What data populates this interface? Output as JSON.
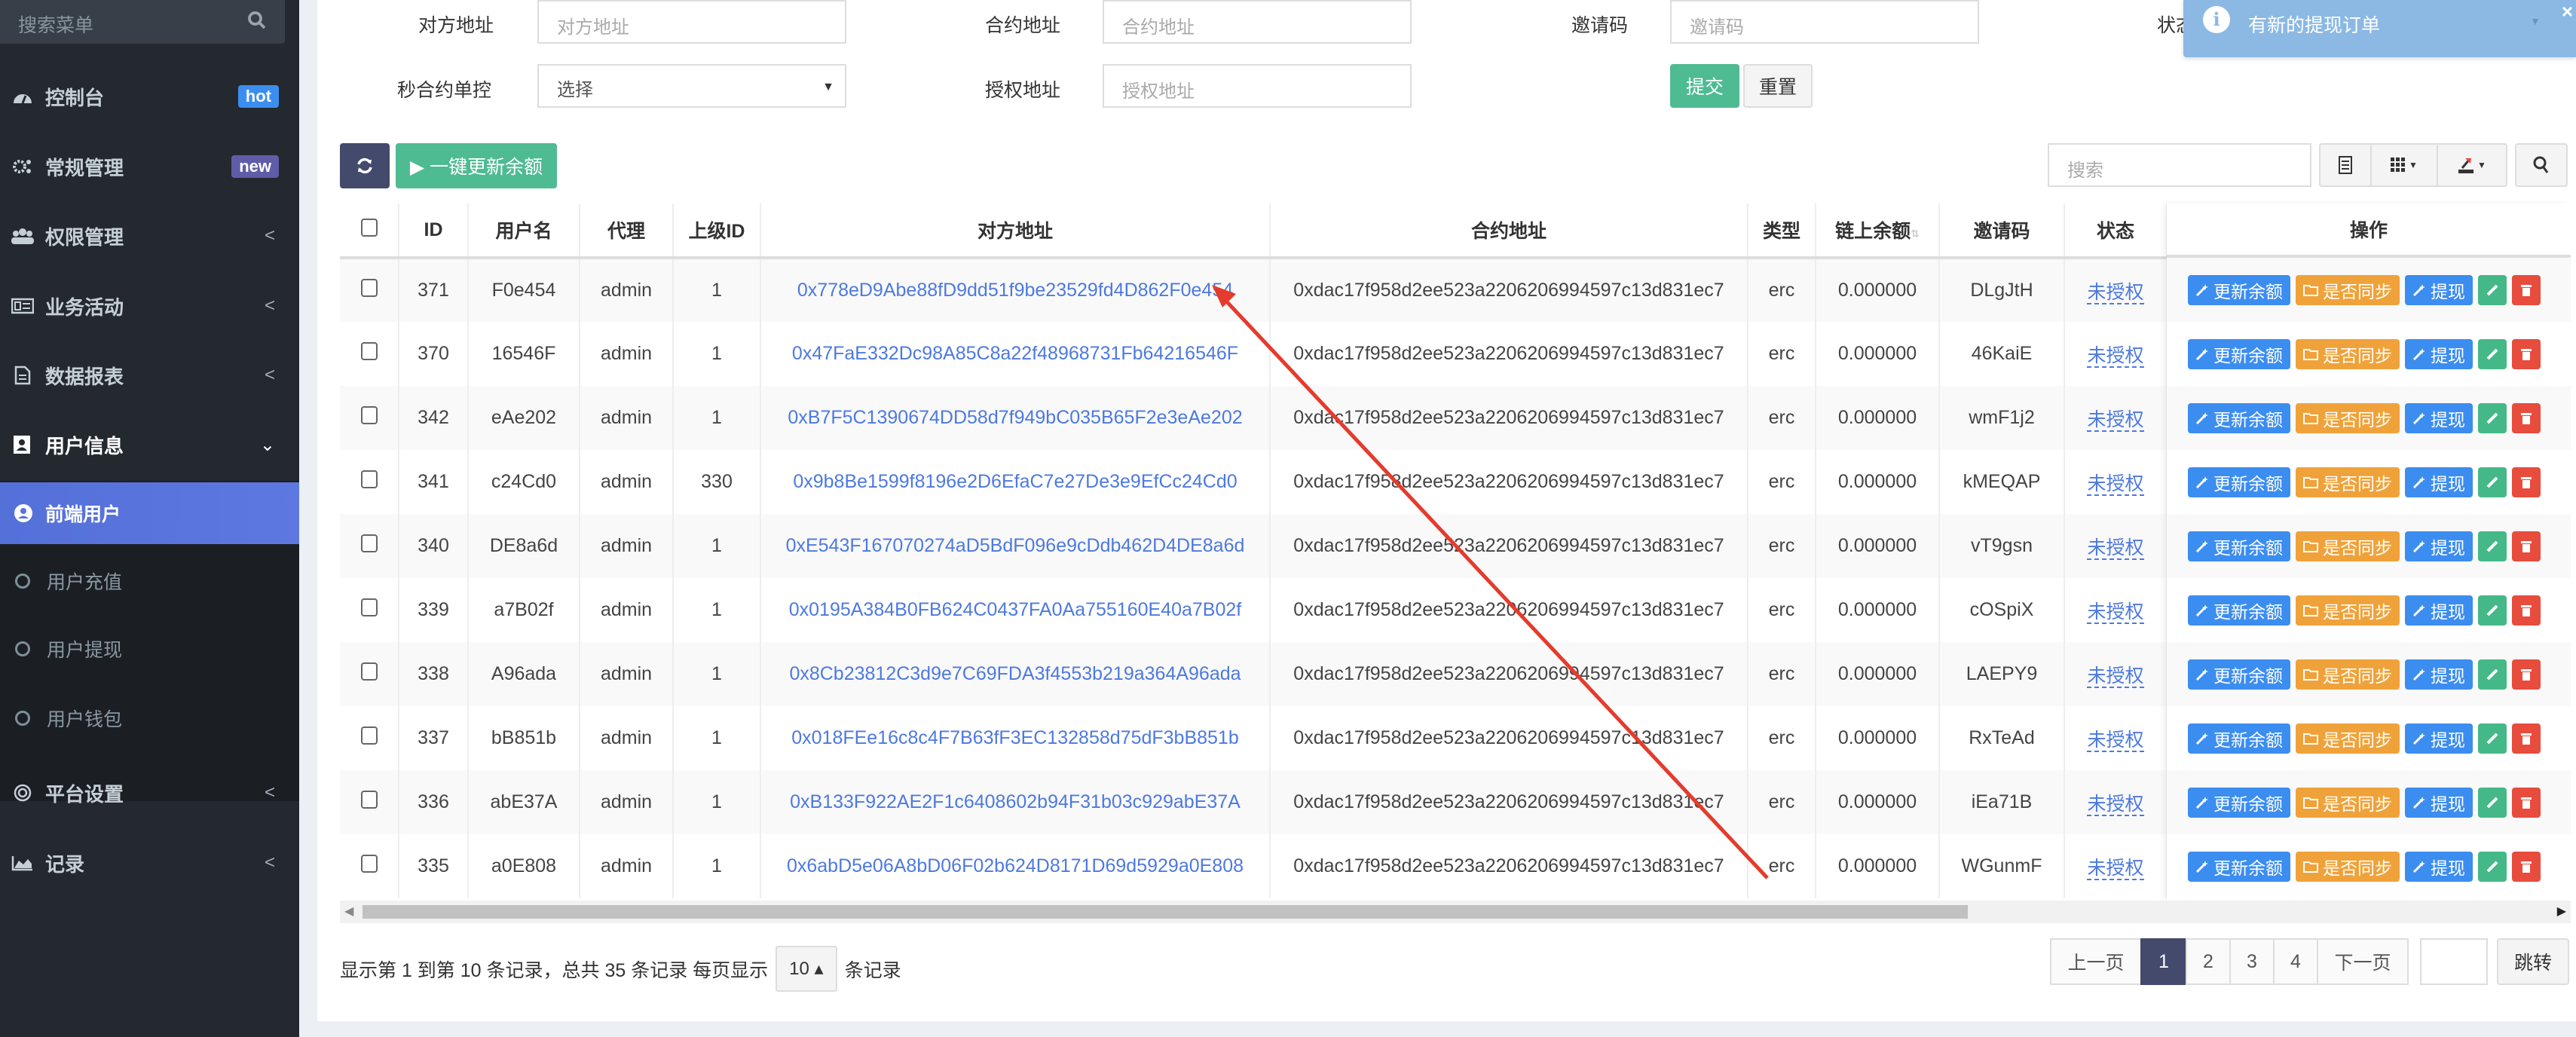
{
  "sidebar": {
    "search_placeholder": "搜索菜单",
    "items": [
      {
        "label": "控制台",
        "badge": "hot",
        "badge_color": "#3c8df0"
      },
      {
        "label": "常规管理",
        "badge": "new",
        "badge_color": "#605ca8"
      },
      {
        "label": "权限管理",
        "chevron": "<"
      },
      {
        "label": "业务活动",
        "chevron": "<"
      },
      {
        "label": "数据报表",
        "chevron": "<"
      },
      {
        "label": "用户信息",
        "chevron": "⌄"
      },
      {
        "label": "平台设置",
        "chevron": "<"
      },
      {
        "label": "记录",
        "chevron": "<"
      }
    ],
    "active_sub": "前端用户",
    "sub_items": [
      "用户充值",
      "用户提现",
      "用户钱包"
    ],
    "active_color": "#5a74dc"
  },
  "filters": {
    "counterparty_label": "对方地址",
    "counterparty_placeholder": "对方地址",
    "contract_label": "合约地址",
    "contract_placeholder": "合约地址",
    "invite_label": "邀请码",
    "invite_placeholder": "邀请码",
    "status_label": "状态",
    "seconds_label": "秒合约单控",
    "seconds_value": "选择",
    "auth_label": "授权地址",
    "auth_placeholder": "授权地址",
    "submit": "提交",
    "reset": "重置"
  },
  "toolbar": {
    "update_all": "▶ 一键更新余额",
    "search_placeholder": "搜索"
  },
  "notification": {
    "message": "有新的提现订单"
  },
  "table": {
    "columns": [
      "ID",
      "用户名",
      "代理",
      "上级ID",
      "对方地址",
      "合约地址",
      "类型",
      "链上余额",
      "邀请码",
      "状态",
      "操作"
    ],
    "rows": [
      {
        "id": "371",
        "username": "F0e454",
        "agent": "admin",
        "parent_id": "1",
        "counterparty": "0x778eD9Abe88fD9dd51f9be23529fd4D862F0e454",
        "contract": "0xdac17f958d2ee523a2206206994597c13d831ec7",
        "type": "erc",
        "balance": "0.000000",
        "invite": "DLgJtH",
        "status": "未授权"
      },
      {
        "id": "370",
        "username": "16546F",
        "agent": "admin",
        "parent_id": "1",
        "counterparty": "0x47FaE332Dc98A85C8a22f48968731Fb64216546F",
        "contract": "0xdac17f958d2ee523a2206206994597c13d831ec7",
        "type": "erc",
        "balance": "0.000000",
        "invite": "46KaiE",
        "status": "未授权"
      },
      {
        "id": "342",
        "username": "eAe202",
        "agent": "admin",
        "parent_id": "1",
        "counterparty": "0xB7F5C1390674DD58d7f949bC035B65F2e3eAe202",
        "contract": "0xdac17f958d2ee523a2206206994597c13d831ec7",
        "type": "erc",
        "balance": "0.000000",
        "invite": "wmF1j2",
        "status": "未授权"
      },
      {
        "id": "341",
        "username": "c24Cd0",
        "agent": "admin",
        "parent_id": "330",
        "counterparty": "0x9b8Be1599f8196e2D6EfaC7e27De3e9EfCc24Cd0",
        "contract": "0xdac17f958d2ee523a2206206994597c13d831ec7",
        "type": "erc",
        "balance": "0.000000",
        "invite": "kMEQAP",
        "status": "未授权"
      },
      {
        "id": "340",
        "username": "DE8a6d",
        "agent": "admin",
        "parent_id": "1",
        "counterparty": "0xE543F167070274aD5BdF096e9cDdb462D4DE8a6d",
        "contract": "0xdac17f958d2ee523a2206206994597c13d831ec7",
        "type": "erc",
        "balance": "0.000000",
        "invite": "vT9gsn",
        "status": "未授权"
      },
      {
        "id": "339",
        "username": "a7B02f",
        "agent": "admin",
        "parent_id": "1",
        "counterparty": "0x0195A384B0FB624C0437FA0Aa755160E40a7B02f",
        "contract": "0xdac17f958d2ee523a2206206994597c13d831ec7",
        "type": "erc",
        "balance": "0.000000",
        "invite": "cOSpiX",
        "status": "未授权"
      },
      {
        "id": "338",
        "username": "A96ada",
        "agent": "admin",
        "parent_id": "1",
        "counterparty": "0x8Cb23812C3d9e7C69FDA3f4553b219a364A96ada",
        "contract": "0xdac17f958d2ee523a2206206994597c13d831ec7",
        "type": "erc",
        "balance": "0.000000",
        "invite": "LAEPY9",
        "status": "未授权"
      },
      {
        "id": "337",
        "username": "bB851b",
        "agent": "admin",
        "parent_id": "1",
        "counterparty": "0x018FEe16c8c4F7B63fF3EC132858d75dF3bB851b",
        "contract": "0xdac17f958d2ee523a2206206994597c13d831ec7",
        "type": "erc",
        "balance": "0.000000",
        "invite": "RxTeAd",
        "status": "未授权"
      },
      {
        "id": "336",
        "username": "abE37A",
        "agent": "admin",
        "parent_id": "1",
        "counterparty": "0xB133F922AE2F1c6408602b94F31b03c929abE37A",
        "contract": "0xdac17f958d2ee523a2206206994597c13d831ec7",
        "type": "erc",
        "balance": "0.000000",
        "invite": "iEa71B",
        "status": "未授权"
      },
      {
        "id": "335",
        "username": "a0E808",
        "agent": "admin",
        "parent_id": "1",
        "counterparty": "0x6abD5e06A8bD06F02b624D8171D69d5929a0E808",
        "contract": "0xdac17f958d2ee523a2206206994597c13d831ec7",
        "type": "erc",
        "balance": "0.000000",
        "invite": "WGunmF",
        "status": "未授权"
      }
    ],
    "row_actions": {
      "update_balance": "更新余额",
      "sync": "是否同步",
      "withdraw": "提现"
    }
  },
  "footer": {
    "summary": "显示第 1 到第 10 条记录，总共 35 条记录 每页显示",
    "page_size": "10 ▴",
    "suffix": "条记录",
    "prev": "上一页",
    "pages": [
      "1",
      "2",
      "3",
      "4"
    ],
    "current_page": "1",
    "next": "下一页",
    "jump": "跳转"
  }
}
